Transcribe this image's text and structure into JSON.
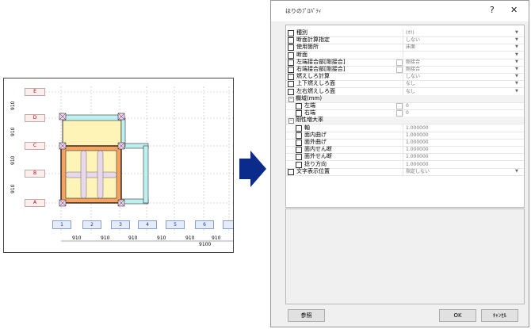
{
  "drawing": {
    "rows": [
      "E",
      "D",
      "C",
      "B",
      "A"
    ],
    "row_dims": [
      "910",
      "910",
      "910",
      "910"
    ],
    "columns": [
      "1",
      "2",
      "3",
      "4",
      "5",
      "6",
      ""
    ],
    "col_dims": [
      "910",
      "910",
      "910",
      "910",
      "910",
      "910"
    ],
    "total_dim": "9100"
  },
  "dialog": {
    "title": "はりのﾌﾟﾛﾊﾟﾃｨ",
    "help": "?",
    "close": "✕",
    "properties": [
      {
        "label": "種別",
        "value": "(ｵﾘ)",
        "dd": true
      },
      {
        "label": "断面計算指定",
        "value": "しない",
        "dd": true
      },
      {
        "label": "使用箇所",
        "value": "床面",
        "dd": true
      },
      {
        "label": "断面",
        "value": "",
        "dd": true
      },
      {
        "label": "左端接合部[剛接合]",
        "value": "剛接合",
        "dd": true,
        "vchk": true
      },
      {
        "label": "右端接合部[剛接合]",
        "value": "剛接合",
        "dd": true,
        "vchk": true
      },
      {
        "label": "燃えしろ計算",
        "value": "しない",
        "dd": true
      },
      {
        "label": "上下燃えしろ面",
        "value": "なし",
        "dd": true
      },
      {
        "label": "左右燃えしろ面",
        "value": "なし",
        "dd": true
      },
      {
        "category": true,
        "label": "欄域(mm)"
      },
      {
        "label": "左端",
        "value": "0",
        "sub": true,
        "vchk": true
      },
      {
        "label": "右端",
        "value": "0",
        "sub": true,
        "vchk": true
      },
      {
        "category": true,
        "label": "剛性増大率"
      },
      {
        "label": "軸",
        "value": "1.000000",
        "sub": true
      },
      {
        "label": "面内曲げ",
        "value": "1.000000",
        "sub": true
      },
      {
        "label": "面外曲げ",
        "value": "1.000000",
        "sub": true
      },
      {
        "label": "面内せん断",
        "value": "1.000000",
        "sub": true
      },
      {
        "label": "面外せん断",
        "value": "1.000000",
        "sub": true
      },
      {
        "label": "捻り方向",
        "value": "1.000000",
        "sub": true
      },
      {
        "label": "文字表示位置",
        "value": "指定しない",
        "dd": true
      }
    ],
    "buttons": {
      "ref": "参照",
      "ok": "OK",
      "cancel": "ｷｬﾝｾﾙ"
    }
  },
  "colors": {
    "accent": "#1c3c8c",
    "arrow": "#0a2a8c",
    "beam_orange": "#f4a460",
    "beam_cyan": "#7fd6d6",
    "beam_yellow": "#fff4b8"
  }
}
